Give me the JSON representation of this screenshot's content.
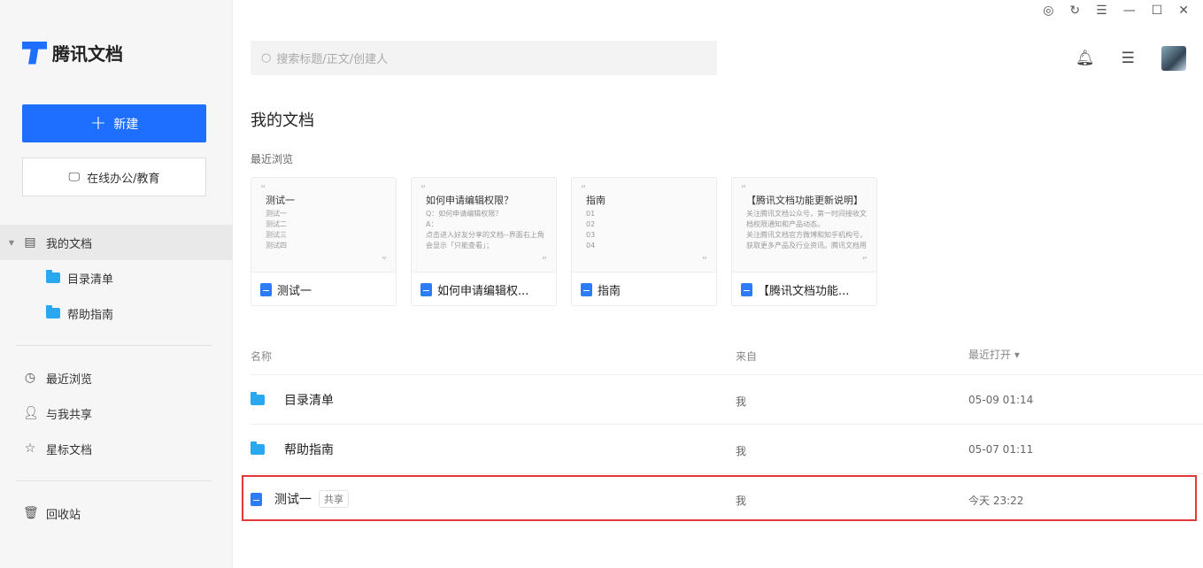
{
  "app": {
    "name": "腾讯文档",
    "brand_color": "#1e6fff"
  },
  "window_controls": [
    "compass-icon",
    "refresh-icon",
    "menu-icon",
    "minimize-icon",
    "maximize-icon",
    "close-icon"
  ],
  "sidebar": {
    "new_label": "新建",
    "edu_label": "在线办公/教育",
    "my_docs": "我的文档",
    "folders": [
      "目录清单",
      "帮助指南"
    ],
    "items": [
      {
        "label": "最近浏览",
        "icon": "clock-icon"
      },
      {
        "label": "与我共享",
        "icon": "user-icon"
      },
      {
        "label": "星标文档",
        "icon": "star-icon"
      }
    ],
    "trash": "回收站"
  },
  "search": {
    "placeholder": "搜索标题/正文/创建人"
  },
  "main": {
    "title": "我的文档",
    "recent_label": "最近浏览",
    "cards": [
      {
        "heading": "测试一",
        "lines": [
          "测试一",
          "测试二",
          "测试三",
          "测试四"
        ],
        "name": "测试一"
      },
      {
        "heading": "如何申请编辑权限？",
        "lines": [
          "Q：如何申请编辑权限？",
          "A：",
          "点击进入好友分享的文档--界面右上角",
          "会显示「只能查看」；"
        ],
        "name": "如何申请编辑权..."
      },
      {
        "heading": "指南",
        "lines": [
          "01",
          "02",
          "03",
          "04"
        ],
        "name": "指南"
      },
      {
        "heading": "【腾讯文档功能更新说明】",
        "lines": [
          "关注腾讯文档公众号，第一时间接收文",
          "档权限通知和产品动态。",
          "关注腾讯文档官方微博和知乎机构号，",
          "获取更多产品及行业资讯。腾讯文档用"
        ],
        "name": "【腾讯文档功能..."
      }
    ],
    "columns": {
      "name": "名称",
      "from": "来自",
      "opened": "最近打开 ▾"
    },
    "rows": [
      {
        "type": "folder",
        "name": "目录清单",
        "from": "我",
        "opened": "05-09 01:14"
      },
      {
        "type": "folder",
        "name": "帮助指南",
        "from": "我",
        "opened": "05-07 01:11"
      },
      {
        "type": "doc",
        "name": "测试一",
        "badge": "共享",
        "from": "我",
        "opened": "今天 23:22",
        "highlighted": true
      }
    ]
  }
}
